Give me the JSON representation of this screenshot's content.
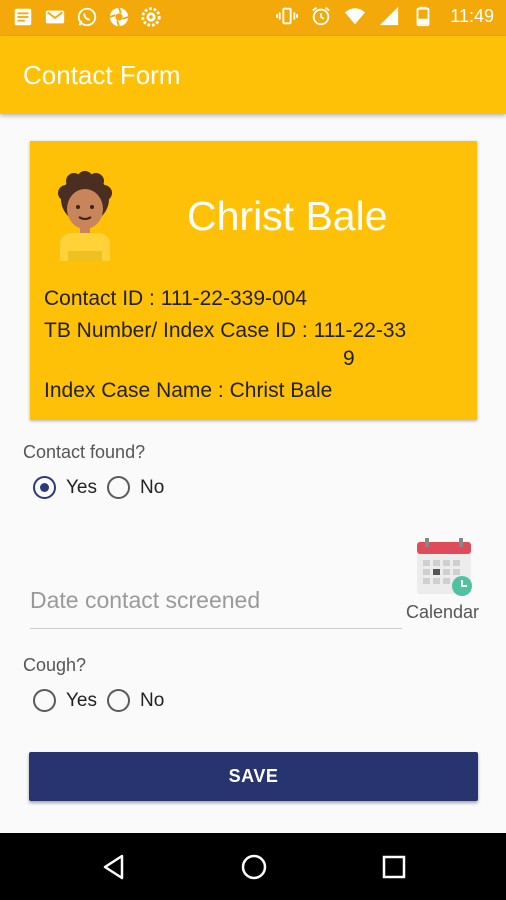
{
  "status_bar": {
    "time": "11:49",
    "notification_icons": [
      "notes-icon",
      "gmail-icon",
      "whatsapp-icon",
      "aperture-icon",
      "settings-icon"
    ],
    "system_icons": [
      "vibrate-icon",
      "alarm-icon",
      "wifi-icon",
      "signal-icon",
      "battery-icon"
    ]
  },
  "app_bar": {
    "title": "Contact Form"
  },
  "card": {
    "name": "Christ Bale",
    "contact_id": "Contact ID : 111-22-339-004",
    "tb_number_line1": "TB Number/ Index Case ID : 111-22-33",
    "tb_number_line2": "9",
    "index_case_prefix": "Index Case Name : ",
    "index_case_name": "Christ Bale"
  },
  "contact_found": {
    "question": "Contact found?",
    "options": [
      "Yes",
      "No"
    ],
    "selected": "Yes"
  },
  "date_field": {
    "placeholder": "Date contact screened",
    "value": ""
  },
  "calendar": {
    "label": "Calendar"
  },
  "cough": {
    "question": "Cough?",
    "options": [
      "Yes",
      "No"
    ],
    "selected": ""
  },
  "save_button": {
    "label": "SAVE"
  },
  "colors": {
    "status_bar": "#f4a90a",
    "primary": "#ffc107",
    "button": "#273470",
    "radio_checked": "#2a3a7a"
  }
}
